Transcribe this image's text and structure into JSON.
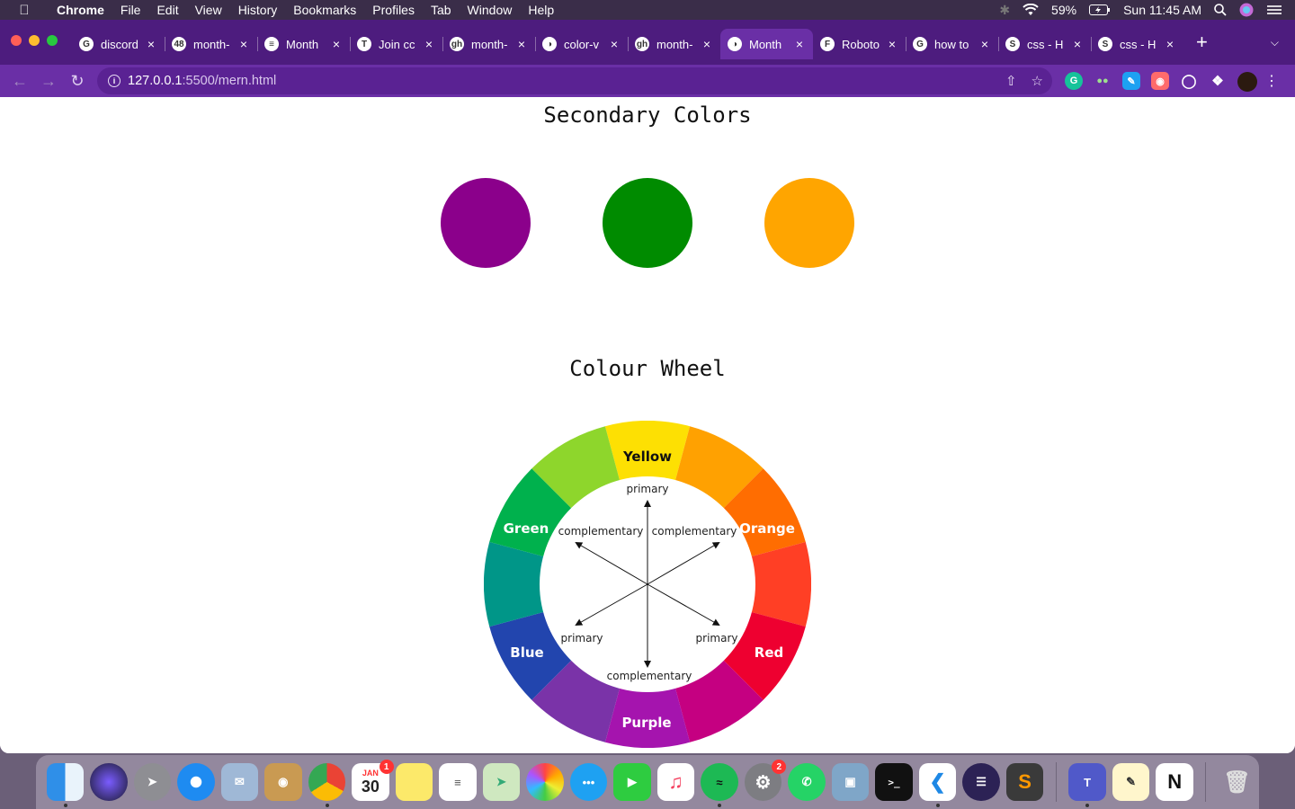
{
  "menubar": {
    "app": "Chrome",
    "items": [
      "File",
      "Edit",
      "View",
      "History",
      "Bookmarks",
      "Profiles",
      "Tab",
      "Window",
      "Help"
    ],
    "battery": "59%",
    "clock": "Sun 11:45 AM"
  },
  "tabs": [
    {
      "title": "discord",
      "icon": "G",
      "color": "#ffffff"
    },
    {
      "title": "month-",
      "icon": "48",
      "color": "#ffffff"
    },
    {
      "title": "Month",
      "icon": "≡",
      "color": "#ffffff"
    },
    {
      "title": "Join cc",
      "icon": "T",
      "color": "#ffffff"
    },
    {
      "title": "month-",
      "icon": "gh",
      "color": "#ffffff"
    },
    {
      "title": "color-v",
      "icon": "◑",
      "color": "#ffffff"
    },
    {
      "title": "month-",
      "icon": "gh",
      "color": "#ffffff"
    },
    {
      "title": "Month",
      "icon": "◑",
      "color": "#ffffff",
      "active": true
    },
    {
      "title": "Roboto",
      "icon": "F",
      "color": "#ffffff"
    },
    {
      "title": "how to",
      "icon": "G",
      "color": "#ffffff"
    },
    {
      "title": "css - H",
      "icon": "S",
      "color": "#ffffff"
    },
    {
      "title": "css - H",
      "icon": "S",
      "color": "#ffffff"
    }
  ],
  "address": {
    "host": "127.0.0.1",
    "path": ":5500/mern.html"
  },
  "page": {
    "secondary_title": "Secondary Colors",
    "secondary_colors": [
      "#8b008b",
      "#008b00",
      "#ffa500"
    ],
    "wheel_title": "Colour Wheel",
    "wheel": {
      "segment_colors": [
        "#fde003",
        "#ffa101",
        "#ff6d01",
        "#ff3f25",
        "#ee0030",
        "#c50081",
        "#a514ae",
        "#7a33a8",
        "#2245ae",
        "#009688",
        "#00b14d",
        "#8ed62c"
      ],
      "labels": {
        "yellow": "Yellow",
        "orange": "Orange",
        "red": "Red",
        "purple": "Purple",
        "blue": "Blue",
        "green": "Green"
      },
      "inner": {
        "top": "primary",
        "top_left": "complementary",
        "top_right": "complementary",
        "bottom_left": "primary",
        "bottom_right": "primary",
        "bottom": "complementary"
      }
    }
  },
  "dock": {
    "calendar_month": "JAN",
    "calendar_day": "30",
    "calendar_badge": "1",
    "settings_badge": "2"
  }
}
